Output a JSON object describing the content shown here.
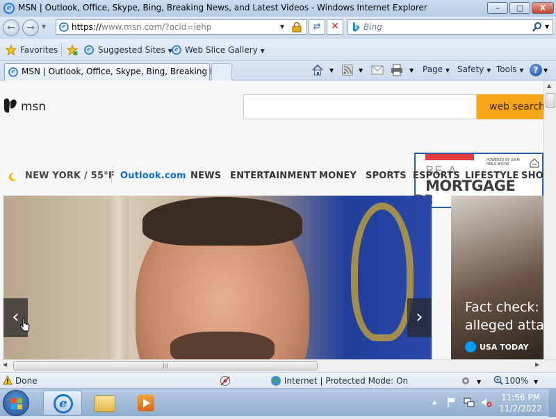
{
  "window": {
    "title": "MSN | Outlook, Office, Skype, Bing, Breaking News, and Latest Videos - Windows Internet Explorer",
    "minimize_glyph": "–",
    "maximize_glyph": "□",
    "close_glyph": "X"
  },
  "address_bar": {
    "url_prefix": "https://",
    "url_host": "www.msn.com",
    "url_rest": "/?ocid=iehp",
    "search_placeholder": "Bing"
  },
  "favorites_bar": {
    "favorites_label": "Favorites",
    "suggested_sites_label": "Suggested Sites",
    "web_slice_label": "Web Slice Gallery"
  },
  "tab": {
    "title": "MSN | Outlook, Office, Skype, Bing, Breaking Ne..."
  },
  "command_bar": {
    "page_label": "Page",
    "safety_label": "Safety",
    "tools_label": "Tools"
  },
  "msn": {
    "logo_text": "msn",
    "search_button": "web search",
    "weather": "NEW YORK / 55°F",
    "nav": [
      "Outlook.com",
      "NEWS",
      "ENTERTAINMENT",
      "MONEY",
      "SPORTS",
      "ESPORTS",
      "LIFESTYLE",
      "SHOP"
    ],
    "ad": {
      "line1": "BE A",
      "line2": "MORTGAGE",
      "line3": "PRO",
      "powered": "POWERED BY UWM NMLS #3038"
    },
    "side_story": {
      "headline_line1": "Fact check: P",
      "headline_line2": "alleged attac",
      "source": "USA TODAY"
    }
  },
  "status_bar": {
    "status": "Done",
    "zone": "Internet | Protected Mode: On",
    "zoom": "100%"
  },
  "taskbar": {
    "time": "11:56 PM",
    "date": "11/2/2022"
  },
  "colors": {
    "accent_orange": "#f7a519",
    "outlook_blue": "#0a6ed1",
    "ad_red": "#e23b3b"
  }
}
